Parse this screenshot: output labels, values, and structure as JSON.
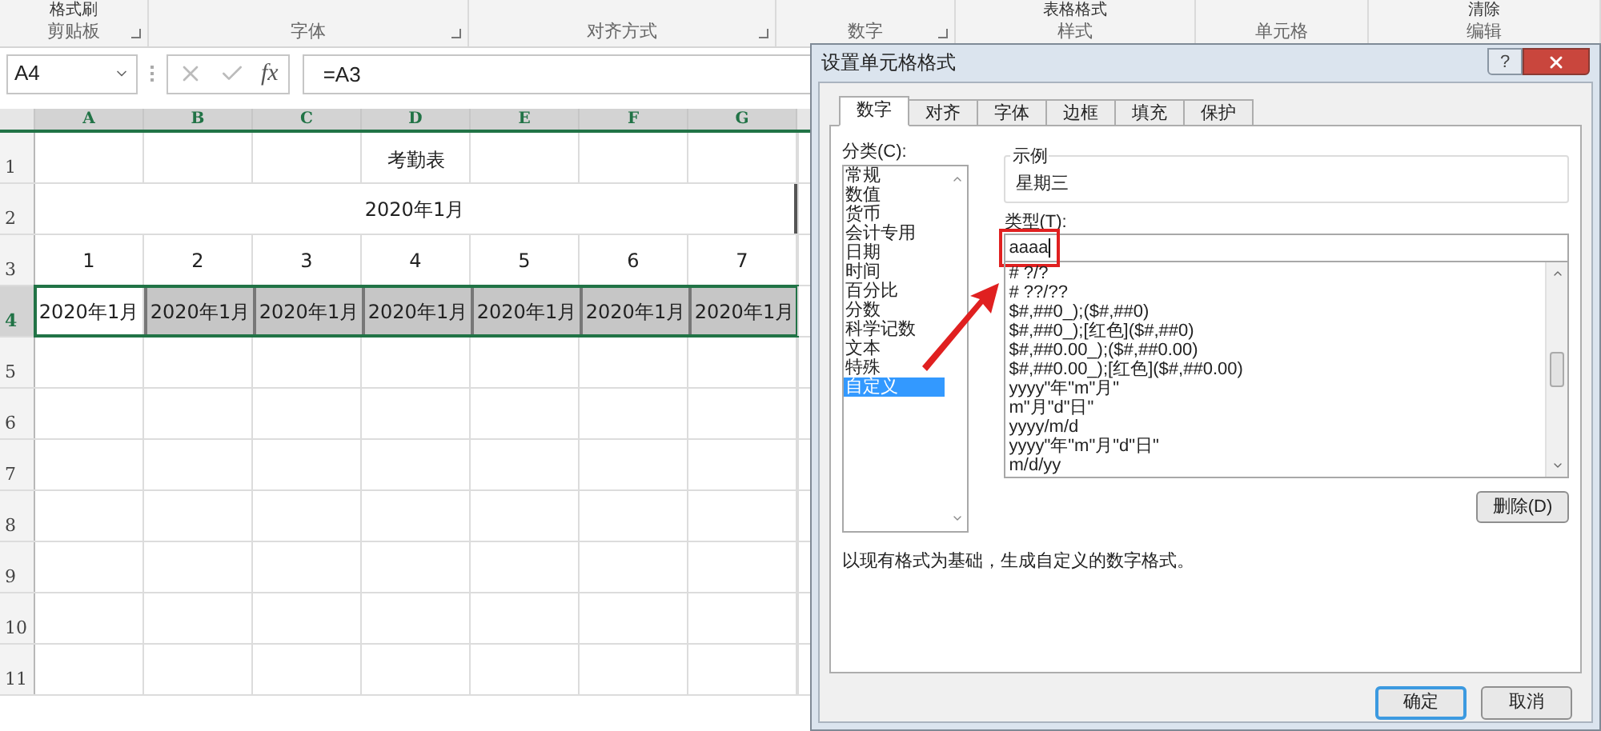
{
  "ribbon": {
    "groups": [
      {
        "label": "剪贴板",
        "command": "格式刷",
        "launcher": true
      },
      {
        "label": "字体",
        "launcher": true
      },
      {
        "label": "对齐方式",
        "launcher": true
      },
      {
        "label": "数字",
        "launcher": true
      },
      {
        "label": "样式",
        "command": "表格格式"
      },
      {
        "label": "单元格"
      },
      {
        "label": "编辑",
        "command": "清除"
      }
    ]
  },
  "formula_bar": {
    "name_box": "A4",
    "function_label": "fx",
    "formula": "=A3"
  },
  "sheet": {
    "columns": [
      {
        "label": "A",
        "selected": true
      },
      {
        "label": "B",
        "selected": true
      },
      {
        "label": "C",
        "selected": true
      },
      {
        "label": "D",
        "selected": true
      },
      {
        "label": "E",
        "selected": true
      },
      {
        "label": "F",
        "selected": true
      },
      {
        "label": "G",
        "selected": true
      }
    ],
    "rows": [
      {
        "header": "1",
        "selected": false,
        "kind": "centered",
        "text": "考勤表"
      },
      {
        "header": "2",
        "selected": false,
        "kind": "merged",
        "text": "2020年1月"
      },
      {
        "header": "3",
        "selected": false,
        "kind": "cells",
        "cells": [
          {
            "text": "1",
            "active": false,
            "shaded": false
          },
          {
            "text": "2",
            "active": false,
            "shaded": false
          },
          {
            "text": "3",
            "active": false,
            "shaded": false
          },
          {
            "text": "4",
            "active": false,
            "shaded": false
          },
          {
            "text": "5",
            "active": false,
            "shaded": false
          },
          {
            "text": "6",
            "active": false,
            "shaded": false
          },
          {
            "text": "7",
            "active": false,
            "shaded": false
          }
        ]
      },
      {
        "header": "4",
        "selected": true,
        "kind": "cells",
        "cells": [
          {
            "text": "2020年1月",
            "active": true,
            "shaded": false
          },
          {
            "text": "2020年1月",
            "active": false,
            "shaded": true
          },
          {
            "text": "2020年1月",
            "active": false,
            "shaded": true
          },
          {
            "text": "2020年1月",
            "active": false,
            "shaded": true
          },
          {
            "text": "2020年1月",
            "active": false,
            "shaded": true
          },
          {
            "text": "2020年1月",
            "active": false,
            "shaded": true
          },
          {
            "text": "2020年1月",
            "active": false,
            "shaded": true
          }
        ]
      },
      {
        "header": "5",
        "selected": false,
        "kind": "empty"
      },
      {
        "header": "6",
        "selected": false,
        "kind": "empty"
      },
      {
        "header": "7",
        "selected": false,
        "kind": "empty"
      },
      {
        "header": "8",
        "selected": false,
        "kind": "empty"
      },
      {
        "header": "9",
        "selected": false,
        "kind": "empty"
      },
      {
        "header": "10",
        "selected": false,
        "kind": "empty"
      },
      {
        "header": "11",
        "selected": false,
        "kind": "empty"
      }
    ]
  },
  "dialog": {
    "title": "设置单元格格式",
    "help": "?",
    "tabs": [
      {
        "label": "数字",
        "selected": true
      },
      {
        "label": "对齐",
        "selected": false
      },
      {
        "label": "字体",
        "selected": false
      },
      {
        "label": "边框",
        "selected": false
      },
      {
        "label": "填充",
        "selected": false
      },
      {
        "label": "保护",
        "selected": false
      }
    ],
    "category_label": "分类(C):",
    "categories": [
      {
        "label": "常规",
        "selected": false
      },
      {
        "label": "数值",
        "selected": false
      },
      {
        "label": "货币",
        "selected": false
      },
      {
        "label": "会计专用",
        "selected": false
      },
      {
        "label": "日期",
        "selected": false
      },
      {
        "label": "时间",
        "selected": false
      },
      {
        "label": "百分比",
        "selected": false
      },
      {
        "label": "分数",
        "selected": false
      },
      {
        "label": "科学记数",
        "selected": false
      },
      {
        "label": "文本",
        "selected": false
      },
      {
        "label": "特殊",
        "selected": false
      },
      {
        "label": "自定义",
        "selected": true
      }
    ],
    "sample_label": "示例",
    "sample_value": "星期三",
    "type_label": "类型(T):",
    "type_value": "aaaa",
    "formats": [
      "# ?/?",
      "# ??/??",
      "$#,##0_);($#,##0)",
      "$#,##0_);[红色]($#,##0)",
      "$#,##0.00_);($#,##0.00)",
      "$#,##0.00_);[红色]($#,##0.00)",
      "yyyy\"年\"m\"月\"",
      "m\"月\"d\"日\"",
      "yyyy/m/d",
      "yyyy\"年\"m\"月\"d\"日\"",
      "m/d/yy"
    ],
    "delete_button": "删除(D)",
    "description": "以现有格式为基础，生成自定义的数字格式。",
    "buttons": [
      {
        "label": "确定",
        "kind": "default"
      },
      {
        "label": "取消",
        "kind": "normal"
      }
    ]
  }
}
